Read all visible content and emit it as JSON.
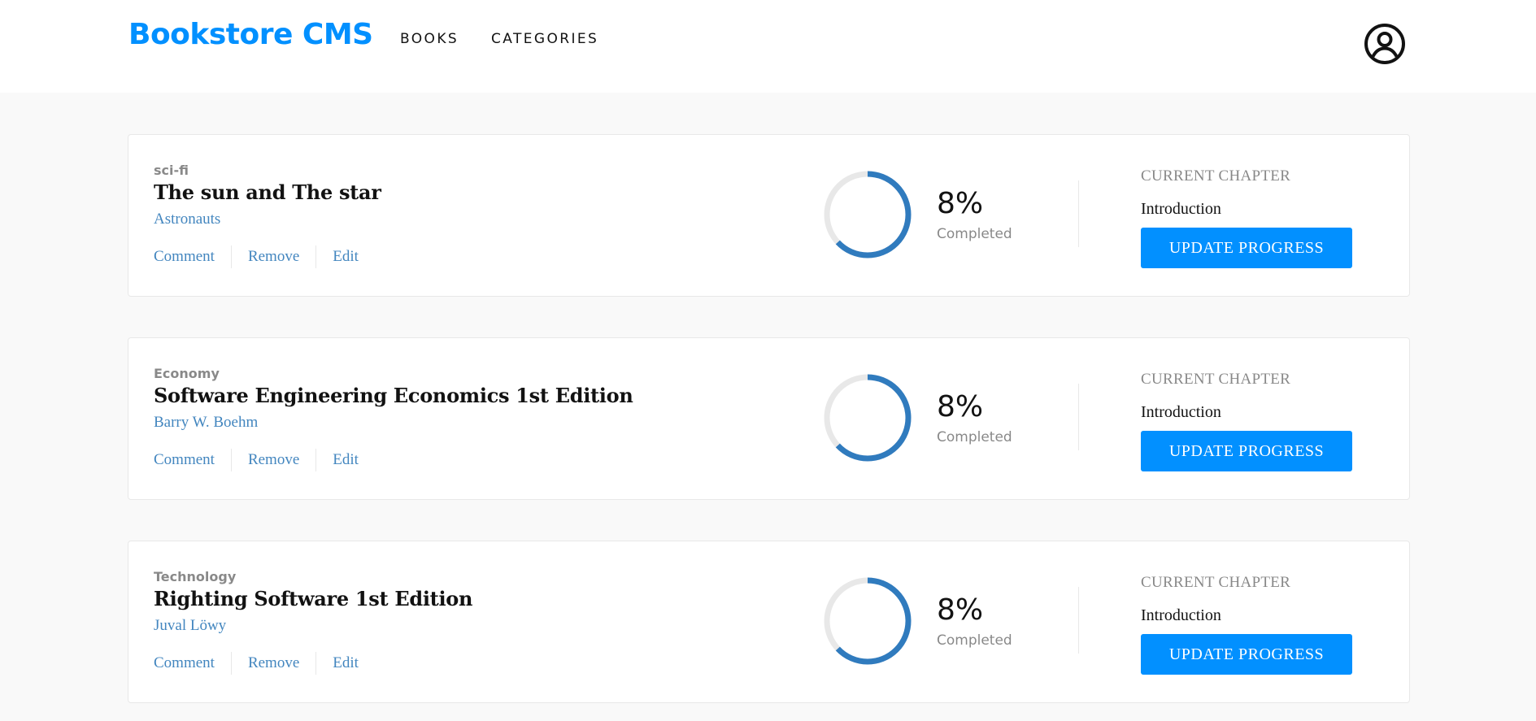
{
  "header": {
    "logo": "Bookstore CMS",
    "nav": {
      "books": "BOOKS",
      "categories": "CATEGORIES"
    },
    "user_icon": "user-circle-icon"
  },
  "colors": {
    "brand": "#0290ff",
    "link": "#4386bf",
    "progress": "#307bbe",
    "track": "#e8e8e8"
  },
  "books": [
    {
      "category": "sci-fi",
      "title": "The sun and The star",
      "author": "Astronauts",
      "actions": {
        "comment": "Comment",
        "remove": "Remove",
        "edit": "Edit"
      },
      "progress_value": 0.08,
      "progress_text": "8%",
      "completed_label": "Completed",
      "chapter_label": "CURRENT CHAPTER",
      "chapter_name": "Introduction",
      "update_label": "UPDATE PROGRESS"
    },
    {
      "category": "Economy",
      "title": "Software Engineering Economics 1st Edition",
      "author": "Barry W. Boehm",
      "actions": {
        "comment": "Comment",
        "remove": "Remove",
        "edit": "Edit"
      },
      "progress_value": 0.08,
      "progress_text": "8%",
      "completed_label": "Completed",
      "chapter_label": "CURRENT CHAPTER",
      "chapter_name": "Introduction",
      "update_label": "UPDATE PROGRESS"
    },
    {
      "category": "Technology",
      "title": "Righting Software 1st Edition",
      "author": "Juval Löwy",
      "actions": {
        "comment": "Comment",
        "remove": "Remove",
        "edit": "Edit"
      },
      "progress_value": 0.08,
      "progress_text": "8%",
      "completed_label": "Completed",
      "chapter_label": "CURRENT CHAPTER",
      "chapter_name": "Introduction",
      "update_label": "UPDATE PROGRESS"
    }
  ]
}
